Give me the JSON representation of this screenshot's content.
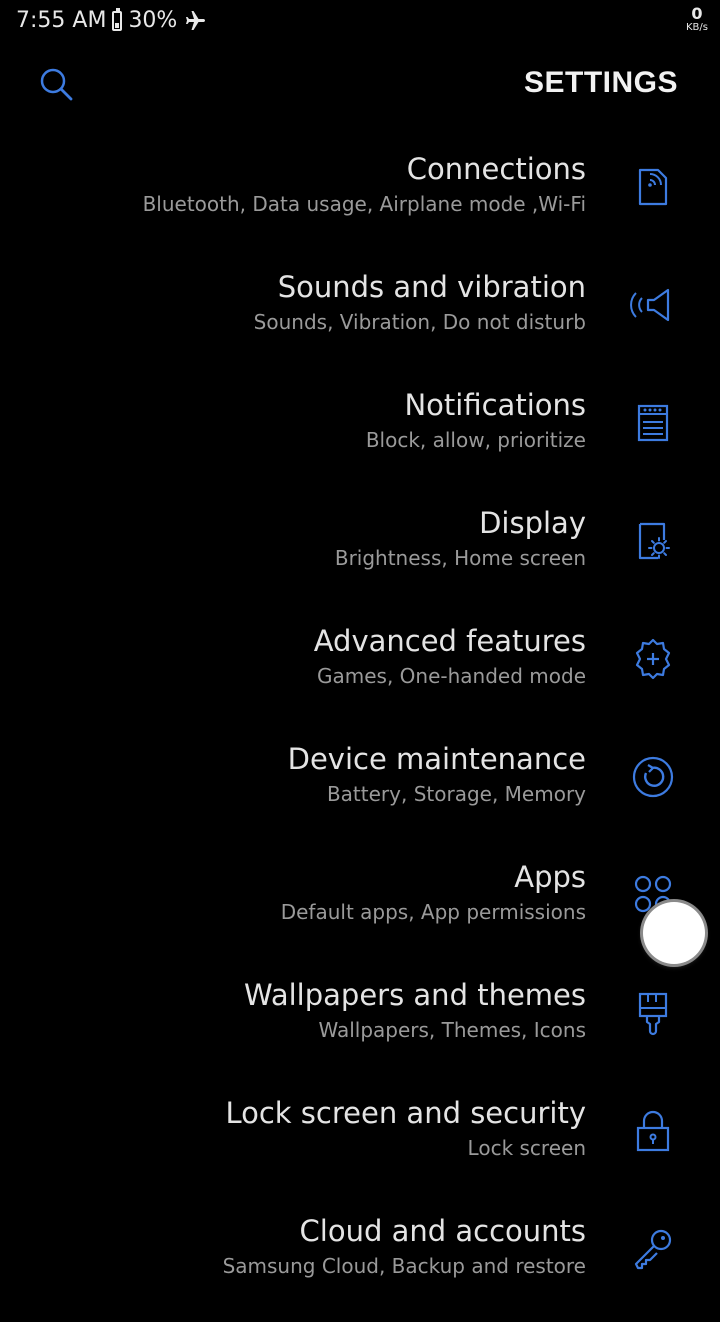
{
  "status": {
    "time": "7:55 AM",
    "battery": "30%",
    "net_speed": "0",
    "net_unit": "KB/s"
  },
  "header": {
    "title": "SETTINGS"
  },
  "accent": "#3d7be0",
  "items": [
    {
      "title": "Connections",
      "subtitle": "Bluetooth, Data usage, Airplane mode ,Wi-Fi",
      "icon": "connections-icon"
    },
    {
      "title": "Sounds and vibration",
      "subtitle": "Sounds, Vibration, Do not disturb",
      "icon": "sound-icon"
    },
    {
      "title": "Notifications",
      "subtitle": "Block, allow, prioritize",
      "icon": "notifications-icon"
    },
    {
      "title": "Display",
      "subtitle": "Brightness, Home screen",
      "icon": "display-icon"
    },
    {
      "title": "Advanced features",
      "subtitle": "Games, One-handed mode",
      "icon": "advanced-features-icon"
    },
    {
      "title": "Device maintenance",
      "subtitle": "Battery, Storage, Memory",
      "icon": "device-maintenance-icon"
    },
    {
      "title": "Apps",
      "subtitle": "Default apps, App permissions",
      "icon": "apps-icon"
    },
    {
      "title": "Wallpapers and themes",
      "subtitle": "Wallpapers, Themes, Icons",
      "icon": "paintbrush-icon"
    },
    {
      "title": "Lock screen and security",
      "subtitle": "Lock screen",
      "icon": "lock-icon"
    },
    {
      "title": "Cloud and accounts",
      "subtitle": "Samsung Cloud, Backup and restore",
      "icon": "key-icon"
    }
  ]
}
